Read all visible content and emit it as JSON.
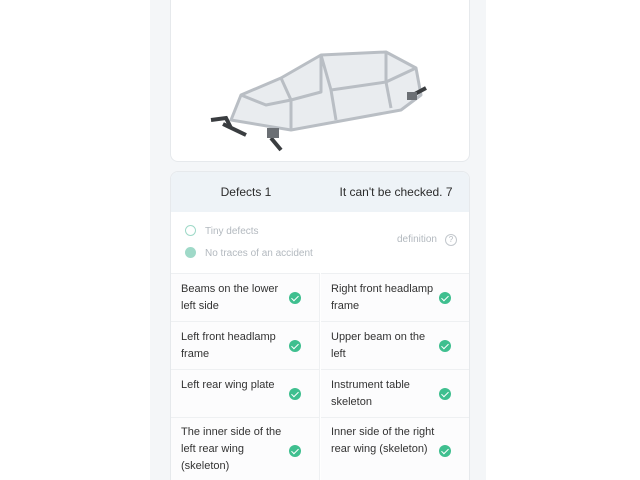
{
  "car_image": {
    "alt": "car body frame"
  },
  "tabs": {
    "defects": "Defects 1",
    "unchecked": "It can't be checked. 7"
  },
  "legend": {
    "tiny_defects": "Tiny defects",
    "no_traces": "No traces of an accident",
    "definition": "definition",
    "help_glyph": "?"
  },
  "items": [
    {
      "label": "Beams on the lower left side",
      "status": "ok"
    },
    {
      "label": "Right front headlamp frame",
      "status": "ok"
    },
    {
      "label": "Left front headlamp frame",
      "status": "ok"
    },
    {
      "label": "Upper beam on the left",
      "status": "ok"
    },
    {
      "label": "Left rear wing plate",
      "status": "ok"
    },
    {
      "label": "Instrument table skeleton",
      "status": "ok"
    },
    {
      "label": "The inner side of the left rear wing (skeleton)",
      "status": "ok"
    },
    {
      "label": "Inner side of the right rear wing (skeleton)",
      "status": "ok"
    }
  ],
  "colors": {
    "ok_check": "#3fbf8f",
    "legend_icon": "#9fd9c8",
    "tab_bg": "#eef3f7"
  }
}
